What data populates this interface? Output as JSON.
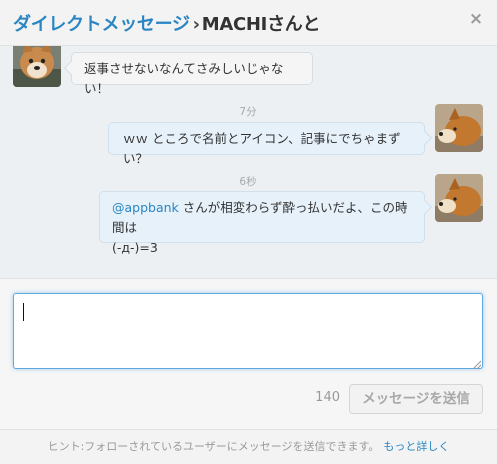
{
  "header": {
    "section_link": "ダイレクトメッセージ",
    "separator": "›",
    "conversation": "MACHIさんと",
    "close_icon": "×"
  },
  "messages": [
    {
      "sender": "them",
      "avatar": "shiba-dog-face-avatar",
      "text": "返事させないなんてさみしいじゃない！"
    },
    {
      "sender": "me",
      "avatar": "shiba-dog-side-avatar",
      "timestamp": "7分",
      "text": "ｗｗ ところで名前とアイコン、記事にでちゃまずい？"
    },
    {
      "sender": "me",
      "avatar": "shiba-dog-side-avatar",
      "timestamp": "6秒",
      "mention": "@appbank",
      "text_line1_rest": " さんが相変わらず酔っ払いだよ、この時間は",
      "text_line2": "(-д-)=3"
    }
  ],
  "composer": {
    "value": "",
    "char_count": "140",
    "send_label": "メッセージを送信"
  },
  "footer": {
    "hint": "ヒント:フォローされているユーザーにメッセージを送信できます。",
    "more_link": "もっと詳しく"
  },
  "colors": {
    "accent": "#2a86c3",
    "thread_bg": "#edf0f3",
    "my_bubble": "#e6f1fa",
    "their_bubble": "#f5f5f5"
  }
}
